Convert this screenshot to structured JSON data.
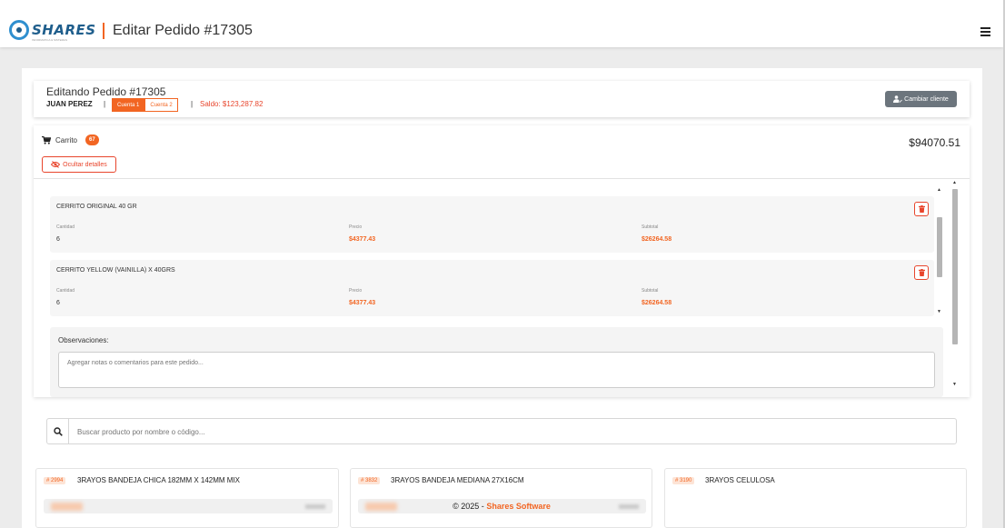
{
  "header": {
    "logo_text": "SHARES",
    "logo_sub": "INFORMATICA & SISTEMAS",
    "title": "Editar Pedido #17305"
  },
  "order": {
    "title": "Editando Pedido #17305",
    "client": "JUAN PEREZ",
    "separator": "|",
    "accounts": [
      "Cuenta 1",
      "Cuenta 2"
    ],
    "saldo": "Saldo: $123,287.82",
    "change_client_label": "Cambiar cliente"
  },
  "cart": {
    "label": "Carrito",
    "count": "67",
    "total": "$94070.51",
    "hide_details_label": "Ocultar detalles",
    "items": [
      {
        "name": "CERRITO ORIGINAL 40 GR",
        "qty_label": "Cantidad",
        "qty": "6",
        "price_label": "Precio",
        "price": "$4377.43",
        "subtotal_label": "Subtotal",
        "subtotal": "$26264.58"
      },
      {
        "name": "CERRITO YELLOW (VAINILLA) X 40GRS",
        "qty_label": "Cantidad",
        "qty": "6",
        "price_label": "Precio",
        "price": "$4377.43",
        "subtotal_label": "Subtotal",
        "subtotal": "$26264.58"
      }
    ],
    "observations_label": "Observaciones:",
    "observations_placeholder": "Agregar notas o comentarios para este pedido..."
  },
  "search": {
    "placeholder": "Buscar producto por nombre o código..."
  },
  "products": [
    {
      "code": "# 2994",
      "name": "3RAYOS BANDEJA CHICA 182MM X 142MM MIX"
    },
    {
      "code": "# 3832",
      "name": "3RAYOS BANDEJA MEDIANA 27X16CM"
    },
    {
      "code": "# 3190",
      "name": "3RAYOS CELULOSA"
    }
  ],
  "footer": {
    "prefix": "© 2025 -",
    "brand": "Shares Software"
  },
  "colors": {
    "accent": "#f26522",
    "danger": "#e8452c",
    "logo": "#1f5e8c",
    "secondary_button": "#6c757d"
  }
}
